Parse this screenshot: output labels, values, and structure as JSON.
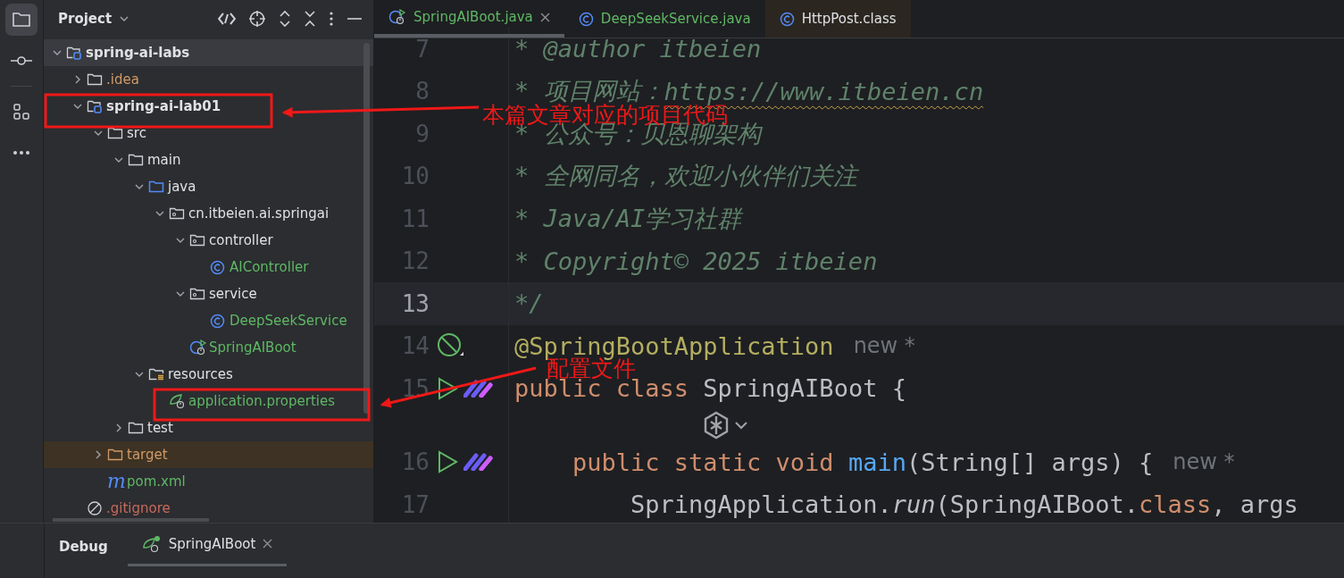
{
  "activity_bar": {
    "items": [
      {
        "kind": "project",
        "selected": true
      },
      {
        "kind": "commit",
        "selected": false
      },
      {
        "kind": "structure",
        "selected": false
      },
      {
        "kind": "more",
        "selected": false
      }
    ]
  },
  "project_panel": {
    "title": "Project",
    "tree": [
      {
        "label": "spring-ai-labs",
        "kind": "module",
        "color": "#dfe1e5",
        "bold": true,
        "selected": true,
        "expanded": true,
        "children": [
          {
            "label": ".idea",
            "kind": "folder",
            "color": "#d19a66",
            "bold": false,
            "selected": false,
            "expanded": false
          },
          {
            "label": "spring-ai-lab01",
            "kind": "module",
            "color": "#dfe1e5",
            "bold": true,
            "selected": false,
            "expanded": true,
            "children": [
              {
                "label": "src",
                "kind": "folder",
                "color": "#dfe1e5",
                "bold": false,
                "selected": false,
                "expanded": true,
                "children": [
                  {
                    "label": "main",
                    "kind": "folder",
                    "color": "#dfe1e5",
                    "bold": false,
                    "selected": false,
                    "expanded": true,
                    "children": [
                      {
                        "label": "java",
                        "kind": "source-folder",
                        "color": "#dfe1e5",
                        "bold": false,
                        "selected": false,
                        "expanded": true,
                        "children": [
                          {
                            "label": "cn.itbeien.ai.springai",
                            "kind": "package",
                            "color": "#dfe1e5",
                            "bold": false,
                            "selected": false,
                            "expanded": true,
                            "children": [
                              {
                                "label": "controller",
                                "kind": "package",
                                "color": "#dfe1e5",
                                "bold": false,
                                "selected": false,
                                "expanded": true,
                                "children": [
                                  {
                                    "label": "AIController",
                                    "kind": "class",
                                    "color": "#5fb865",
                                    "bold": false,
                                    "selected": false
                                  }
                                ]
                              },
                              {
                                "label": "service",
                                "kind": "package",
                                "color": "#dfe1e5",
                                "bold": false,
                                "selected": false,
                                "expanded": true,
                                "children": [
                                  {
                                    "label": "DeepSeekService",
                                    "kind": "class",
                                    "color": "#5fb865",
                                    "bold": false,
                                    "selected": false
                                  }
                                ]
                              },
                              {
                                "label": "SpringAIBoot",
                                "kind": "spring-class",
                                "color": "#5fb865",
                                "bold": false,
                                "selected": false
                              }
                            ]
                          }
                        ]
                      },
                      {
                        "label": "resources",
                        "kind": "resources-folder",
                        "color": "#dfe1e5",
                        "bold": false,
                        "selected": false,
                        "expanded": true,
                        "children": [
                          {
                            "label": "application.properties",
                            "kind": "spring-config",
                            "color": "#5fb865",
                            "bold": false,
                            "selected": false
                          }
                        ]
                      }
                    ]
                  },
                  {
                    "label": "test",
                    "kind": "folder",
                    "color": "#dfe1e5",
                    "bold": false,
                    "selected": false,
                    "expanded": false
                  }
                ]
              },
              {
                "label": "target",
                "kind": "excluded-folder",
                "color": "#d19a66",
                "bold": false,
                "selected": false,
                "expanded": false
              },
              {
                "label": "pom.xml",
                "kind": "maven",
                "glyph": "m",
                "color": "#5fb865",
                "bold": false,
                "selected": false
              }
            ]
          },
          {
            "label": ".gitignore",
            "kind": "ignored",
            "color": "#c8695c",
            "bold": false,
            "selected": false
          }
        ]
      }
    ]
  },
  "editor": {
    "tabs": [
      {
        "label": "SpringAIBoot.java",
        "kind": "spring-class",
        "color": "#5fb865",
        "selected": true,
        "library": false,
        "closable": true
      },
      {
        "label": "DeepSeekService.java",
        "kind": "class",
        "color": "#5fb865",
        "selected": false,
        "library": false,
        "closable": false
      },
      {
        "label": "HttpPost.class",
        "kind": "class",
        "color": "#dfe1e5",
        "selected": false,
        "library": true,
        "closable": false
      }
    ],
    "lines": [
      {
        "kind": "code",
        "number": "7",
        "current": false,
        "segments": [
          {
            "kind": "comment",
            "text": "* @author itbeien"
          }
        ]
      },
      {
        "kind": "code",
        "number": "8",
        "current": false,
        "segments": [
          {
            "kind": "comment",
            "text": "* 项目网站："
          },
          {
            "kind": "comment-link",
            "text": "https://www.itbeien.cn"
          }
        ]
      },
      {
        "kind": "code",
        "number": "9",
        "current": false,
        "segments": [
          {
            "kind": "comment",
            "text": "* 公众号：贝恩聊架构"
          }
        ]
      },
      {
        "kind": "code",
        "number": "10",
        "current": false,
        "segments": [
          {
            "kind": "comment",
            "text": "* 全网同名，欢迎小伙伴们关注"
          }
        ]
      },
      {
        "kind": "code",
        "number": "11",
        "current": false,
        "segments": [
          {
            "kind": "comment",
            "text": "* Java/AI学习社群"
          }
        ]
      },
      {
        "kind": "code",
        "number": "12",
        "current": false,
        "segments": [
          {
            "kind": "comment",
            "text": "* Copyright© 2025 itbeien"
          }
        ]
      },
      {
        "kind": "code",
        "number": "13",
        "current": true,
        "segments": [
          {
            "kind": "comment",
            "text": "*/"
          }
        ]
      },
      {
        "kind": "code",
        "number": "14",
        "current": false,
        "gutter": [
          {
            "kind": "bean"
          }
        ],
        "segments": [
          {
            "kind": "annotation",
            "text": "@SpringBootApplication"
          },
          {
            "kind": "hint",
            "text": "new *"
          }
        ]
      },
      {
        "kind": "code",
        "number": "15",
        "current": false,
        "gutter": [
          {
            "kind": "run"
          },
          {
            "kind": "ai"
          }
        ],
        "segments": [
          {
            "kind": "keyword",
            "text": "public class "
          },
          {
            "kind": "plain",
            "text": "SpringAIBoot {"
          }
        ]
      },
      {
        "kind": "inlay"
      },
      {
        "kind": "code",
        "number": "16",
        "current": false,
        "gutter": [
          {
            "kind": "run"
          },
          {
            "kind": "ai"
          }
        ],
        "segments": [
          {
            "kind": "keyword",
            "text": "    public static void "
          },
          {
            "kind": "method",
            "text": "main"
          },
          {
            "kind": "plain",
            "text": "(String[] args) {"
          },
          {
            "kind": "hint",
            "text": "new *"
          }
        ]
      },
      {
        "kind": "code",
        "number": "17",
        "current": false,
        "segments": [
          {
            "kind": "plain",
            "text": "        SpringApplication."
          },
          {
            "kind": "static-call",
            "text": "run"
          },
          {
            "kind": "plain",
            "text": "(SpringAIBoot."
          },
          {
            "kind": "keyword",
            "text": "class"
          },
          {
            "kind": "plain",
            "text": ", args"
          }
        ]
      }
    ]
  },
  "bottom_panel": {
    "title": "Debug",
    "tabs": [
      {
        "label": "SpringAIBoot",
        "selected": true
      }
    ]
  },
  "annotations": [
    {
      "text": "本篇文章对应的项目代码"
    },
    {
      "text": "配置文件"
    }
  ]
}
